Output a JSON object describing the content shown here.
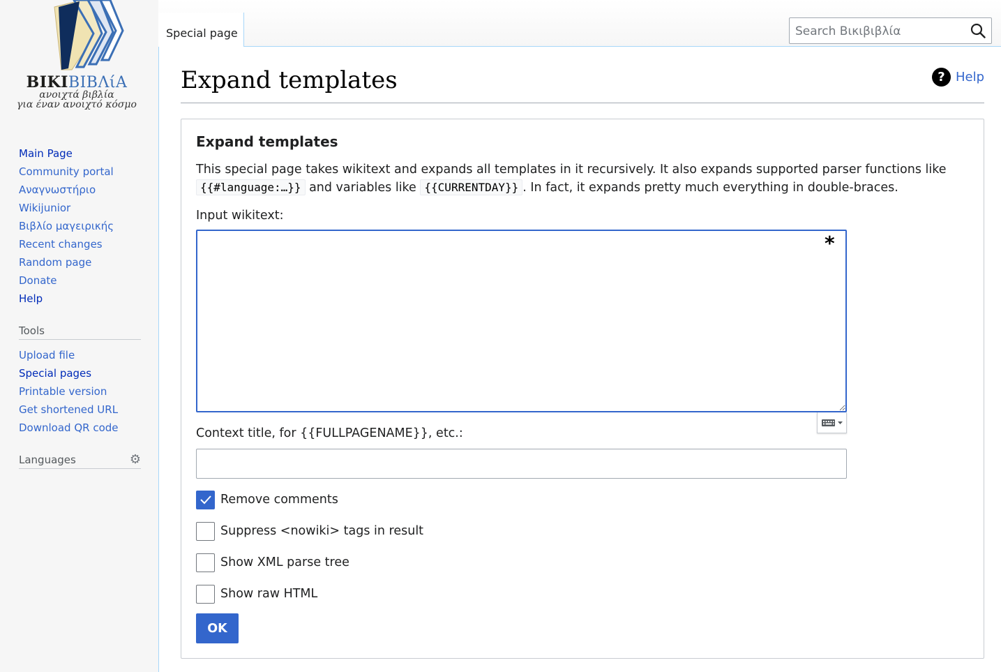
{
  "logo": {
    "wordmark_dark": "ΒΙΚΙ",
    "wordmark_blue": "ΒΙΒΛίΑ",
    "tagline_1": "ανοιχτά βιβλία",
    "tagline_2": "για έναν ανοιχτό κόσμο"
  },
  "sidebar": {
    "main_nav": [
      {
        "label": "Main Page"
      },
      {
        "label": "Community portal"
      },
      {
        "label": "Αναγνωστήριο"
      },
      {
        "label": "Wikijunior"
      },
      {
        "label": "Βιβλίο μαγειρικής"
      },
      {
        "label": "Recent changes"
      },
      {
        "label": "Random page"
      },
      {
        "label": "Donate"
      },
      {
        "label": "Help"
      }
    ],
    "tools_heading": "Tools",
    "tools": [
      {
        "label": "Upload file"
      },
      {
        "label": "Special pages"
      },
      {
        "label": "Printable version"
      },
      {
        "label": "Get shortened URL"
      },
      {
        "label": "Download QR code"
      }
    ],
    "languages_heading": "Languages"
  },
  "header": {
    "tab_label": "Special page",
    "search_placeholder": "Search Βικιβιβλία"
  },
  "page": {
    "title": "Expand templates",
    "help_label": "Help"
  },
  "form": {
    "legend": "Expand templates",
    "intro_part1": "This special page takes wikitext and expands all templates in it recursively. It also expands supported parser functions like ",
    "intro_code1": "{{#language:…}}",
    "intro_part2": " and variables like ",
    "intro_code2": "{{CURRENTDAY}}",
    "intro_part3": ". In fact, it expands pretty much everything in double-braces.",
    "input_label": "Input wikitext:",
    "input_value": "",
    "required_marker": "*",
    "context_label": "Context title, for {{FULLPAGENAME}}, etc.:",
    "context_value": "",
    "checkboxes": [
      {
        "label": "Remove comments",
        "checked": true
      },
      {
        "label": "Suppress <nowiki> tags in result",
        "checked": false
      },
      {
        "label": "Show XML parse tree",
        "checked": false
      },
      {
        "label": "Show raw HTML",
        "checked": false
      }
    ],
    "submit_label": "OK"
  },
  "colors": {
    "accent": "#3366cc",
    "link_visited": "#0645ad",
    "border_blue": "#a7d7f9"
  }
}
